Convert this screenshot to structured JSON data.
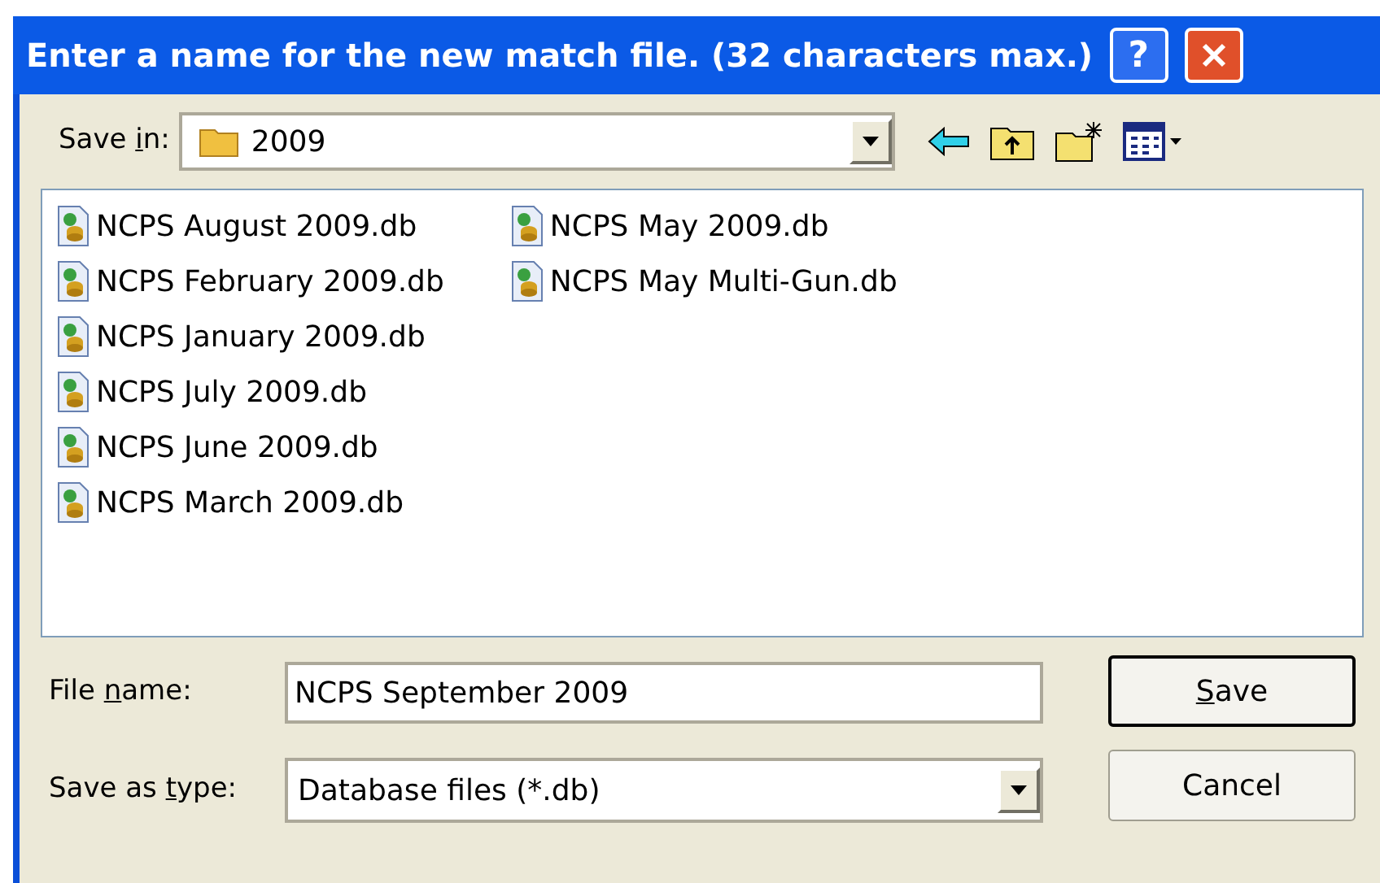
{
  "window": {
    "title": "Enter a name for the new match file. (32 characters max.)",
    "help_button": "?"
  },
  "save_in": {
    "label_parts": [
      {
        "text": "Save ",
        "underlined": false
      },
      {
        "text": "i",
        "underlined": true
      },
      {
        "text": "n:",
        "underlined": false
      }
    ],
    "value": "2009"
  },
  "files": [
    {
      "name": "NCPS August 2009.db"
    },
    {
      "name": "NCPS February 2009.db"
    },
    {
      "name": "NCPS January 2009.db"
    },
    {
      "name": "NCPS July 2009.db"
    },
    {
      "name": "NCPS June 2009.db"
    },
    {
      "name": "NCPS March 2009.db"
    },
    {
      "name": "NCPS May 2009.db"
    },
    {
      "name": "NCPS May Multi-Gun.db"
    }
  ],
  "file_name": {
    "label_parts": [
      {
        "text": "File ",
        "underlined": false
      },
      {
        "text": "n",
        "underlined": true
      },
      {
        "text": "ame:",
        "underlined": false
      }
    ],
    "value": "NCPS September 2009"
  },
  "save_as_type": {
    "label_parts": [
      {
        "text": "Save as ",
        "underlined": false
      },
      {
        "text": "t",
        "underlined": true
      },
      {
        "text": "ype:",
        "underlined": false
      }
    ],
    "value": "Database files (*.db)"
  },
  "buttons": [
    {
      "label_parts": [
        {
          "text": "S",
          "underlined": true
        },
        {
          "text": "ave",
          "underlined": false
        }
      ],
      "default": true
    },
    {
      "label_parts": [
        {
          "text": "Cancel",
          "underlined": false
        }
      ],
      "default": false
    }
  ]
}
